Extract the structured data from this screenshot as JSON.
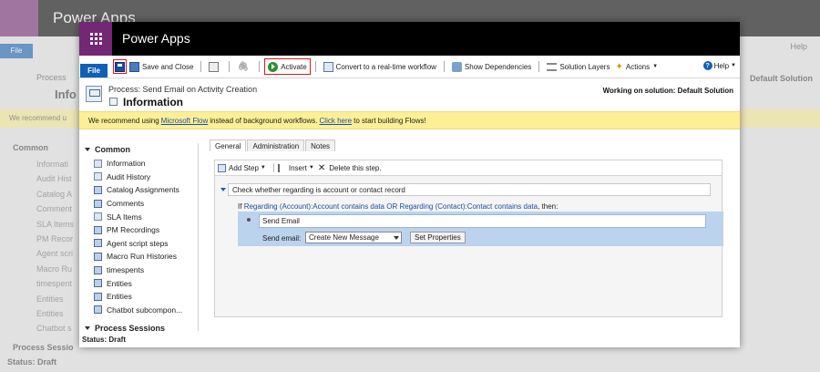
{
  "app": {
    "brand": "Power Apps"
  },
  "ribbon": {
    "file": "File",
    "save_close": "Save and Close",
    "activate": "Activate",
    "convert": "Convert to a real-time workflow",
    "show_dependencies": "Show Dependencies",
    "solution_layers": "Solution Layers",
    "actions": "Actions",
    "help": "Help"
  },
  "header": {
    "process": "Process: Send Email on Activity Creation",
    "title": "Information",
    "solution": "Working on solution: Default Solution"
  },
  "banner": {
    "pre": "We recommend using",
    "link1": "Microsoft Flow",
    "mid": "instead of background workflows.",
    "link2": "Click here",
    "post": "to start building Flows!"
  },
  "nav": {
    "common": "Common",
    "items": [
      "Information",
      "Audit History",
      "Catalog Assignments",
      "Comments",
      "SLA Items",
      "PM Recordings",
      "Agent script steps",
      "Macro Run Histories",
      "timespents",
      "Entities",
      "Entities",
      "Chatbot subcompon..."
    ],
    "process_sessions": "Process Sessions",
    "status": "Status: Draft"
  },
  "tabs": [
    "General",
    "Administration",
    "Notes"
  ],
  "toolbar": {
    "add_step": "Add Step",
    "insert": "Insert",
    "delete": "Delete this step."
  },
  "step": {
    "check": "Check whether regarding is account or contact record",
    "if_prefix": "If",
    "condition": "Regarding (Account):Account contains data OR Regarding (Contact):Contact contains data",
    "then": ", then:",
    "send_email": "Send Email",
    "send_label": "Send email:",
    "select_value": "Create New Message",
    "set_properties": "Set Properties"
  },
  "background": {
    "help": "Help",
    "process": "Process",
    "info": "Info",
    "solution": "Default Solution",
    "banner": "We recommend u",
    "common": "Common",
    "items": [
      "Informati",
      "Audit Hist",
      "Catalog A",
      "Comment",
      "SLA Items",
      "PM Recor",
      "Agent scri",
      "Macro Ru",
      "timespent",
      "Entities",
      "Entities",
      "Chatbot s"
    ],
    "process_sessions": "Process Sessio",
    "status": "Status: Draft"
  }
}
